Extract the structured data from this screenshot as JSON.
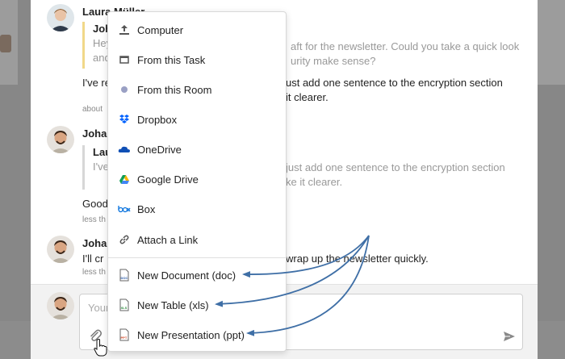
{
  "colors": {
    "accent_arrow": "#3f6fa6",
    "quote_yellow": "#f1d889",
    "dropbox_blue": "#0061fe",
    "onedrive_blue": "#0f4fb5",
    "box_blue": "#0b74de",
    "doc_blue": "#2a5aa8",
    "xls_green": "#2c8a3c",
    "ppt_orange": "#d24726"
  },
  "messages": [
    {
      "author": "Laura Müller",
      "quote": {
        "author": "Joh",
        "lines": [
          "Hey",
          "and"
        ],
        "right_lines": [
          "aft for the newsletter. Could you take a quick look",
          "urity make sense?"
        ]
      },
      "text_left": [
        "I've re",
        "about"
      ],
      "text_right": [
        "ust add one sentence to the encryption section",
        "it clearer."
      ],
      "meta": "about"
    },
    {
      "author": "Johan",
      "quote": {
        "author": "Lau",
        "lines": [
          "I've",
          ""
        ],
        "right_lines": [
          "just add one sentence to the encryption section",
          "ke it clearer."
        ]
      },
      "text_left": [
        "Good"
      ],
      "meta": "less th"
    },
    {
      "author": "Johan",
      "text_left": [
        "I'll cr"
      ],
      "text_right": [
        "wrap up the newsletter quickly."
      ],
      "meta": "less th"
    }
  ],
  "composer": {
    "placeholder": "Your"
  },
  "attach_menu": {
    "items": [
      {
        "label": "Computer",
        "icon": "upload-icon"
      },
      {
        "label": "From this Task",
        "icon": "task-icon"
      },
      {
        "label": "From this Room",
        "icon": "room-icon"
      },
      {
        "label": "Dropbox",
        "icon": "dropbox-icon"
      },
      {
        "label": "OneDrive",
        "icon": "onedrive-icon"
      },
      {
        "label": "Google Drive",
        "icon": "google-drive-icon"
      },
      {
        "label": "Box",
        "icon": "box-icon"
      },
      {
        "label": "Attach a Link",
        "icon": "link-icon"
      }
    ],
    "new_items": [
      {
        "label": "New Document (doc)",
        "icon": "doc-icon",
        "tag": "DOC"
      },
      {
        "label": "New Table (xls)",
        "icon": "xls-icon",
        "tag": "XLS"
      },
      {
        "label": "New Presentation (ppt)",
        "icon": "ppt-icon",
        "tag": "PPT"
      }
    ]
  },
  "icons": {
    "paperclip": "paperclip-icon",
    "send": "send-icon",
    "cursor": "hand-cursor-icon"
  }
}
